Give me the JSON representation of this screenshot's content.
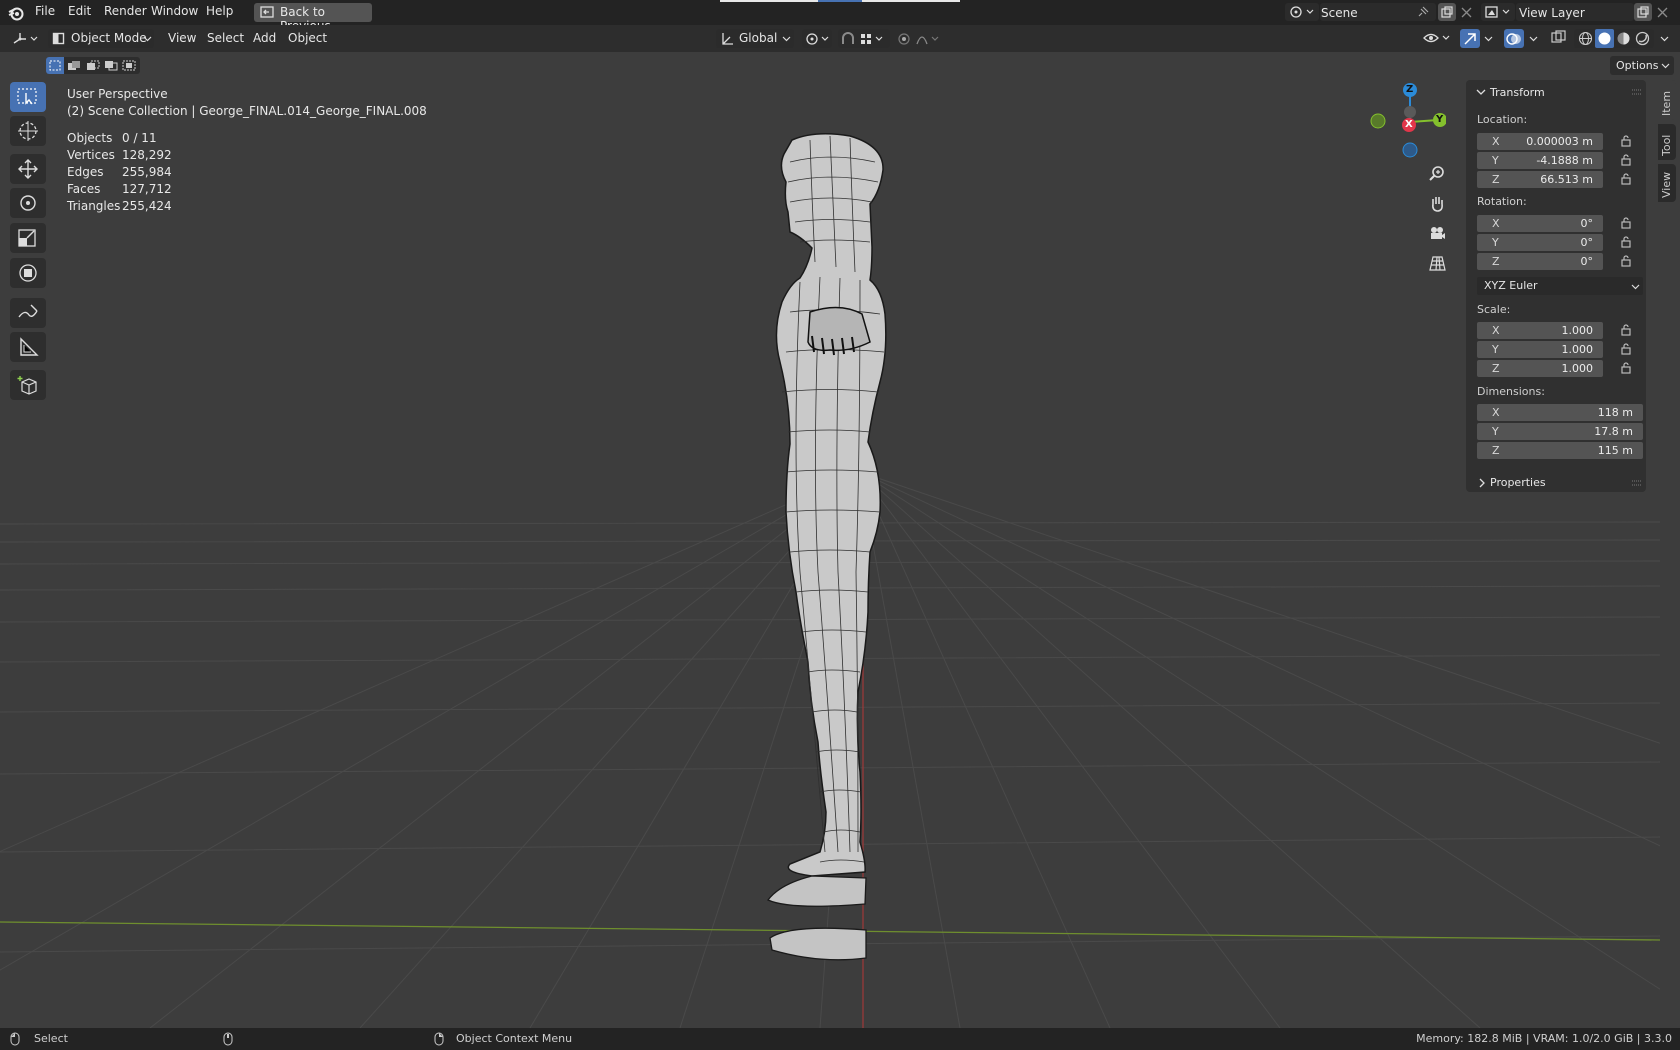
{
  "topbar": {
    "menus": [
      "File",
      "Edit",
      "Render",
      "Window",
      "Help"
    ],
    "back_button": "Back to Previous",
    "scene_label": "Scene",
    "view_layer_label": "View Layer"
  },
  "header": {
    "mode": "Object Mode",
    "menus": [
      "View",
      "Select",
      "Add",
      "Object"
    ],
    "orientation": "Global",
    "options": "Options"
  },
  "overlay": {
    "perspective": "User Perspective",
    "collection": "(2) Scene Collection | George_FINAL.014_George_FINAL.008",
    "stats": [
      {
        "label": "Objects",
        "value": "0 / 11"
      },
      {
        "label": "Vertices",
        "value": "128,292"
      },
      {
        "label": "Edges",
        "value": "255,984"
      },
      {
        "label": "Faces",
        "value": "127,712"
      },
      {
        "label": "Triangles",
        "value": "255,424"
      }
    ]
  },
  "gizmo": {
    "z": "Z",
    "y": "Y",
    "x": "X"
  },
  "panel": {
    "title": "Transform",
    "location_label": "Location:",
    "location": [
      {
        "axis": "X",
        "value": "0.000003 m"
      },
      {
        "axis": "Y",
        "value": "-4.1888 m"
      },
      {
        "axis": "Z",
        "value": "66.513 m"
      }
    ],
    "rotation_label": "Rotation:",
    "rotation": [
      {
        "axis": "X",
        "value": "0°"
      },
      {
        "axis": "Y",
        "value": "0°"
      },
      {
        "axis": "Z",
        "value": "0°"
      }
    ],
    "rotation_mode": "XYZ Euler",
    "scale_label": "Scale:",
    "scale": [
      {
        "axis": "X",
        "value": "1.000"
      },
      {
        "axis": "Y",
        "value": "1.000"
      },
      {
        "axis": "Z",
        "value": "1.000"
      }
    ],
    "dimensions_label": "Dimensions:",
    "dimensions": [
      {
        "axis": "X",
        "value": "118 m"
      },
      {
        "axis": "Y",
        "value": "17.8 m"
      },
      {
        "axis": "Z",
        "value": "115 m"
      }
    ],
    "properties": "Properties",
    "tabs": [
      "Item",
      "Tool",
      "View"
    ]
  },
  "status": {
    "left": "Select",
    "middle": "Object Context Menu",
    "right": "Memory: 182.8 MiB | VRAM: 1.0/2.0 GiB | 3.3.0"
  },
  "colors": {
    "accent": "#4772b3",
    "x_axis": "#e2364a",
    "y_axis": "#84c02d",
    "z_axis": "#2b8bd8"
  }
}
